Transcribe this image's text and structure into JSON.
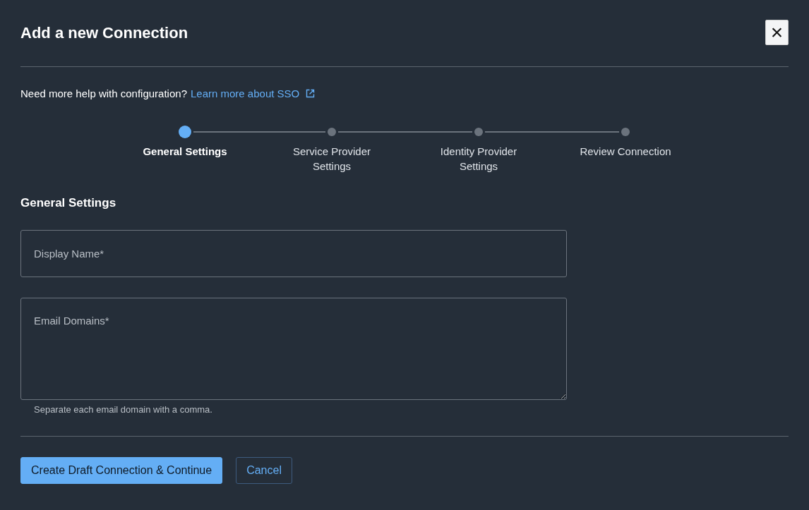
{
  "dialog": {
    "title": "Add a new Connection",
    "close_icon": "×"
  },
  "help": {
    "text": "Need more help with configuration?",
    "link": "Learn more about SSO"
  },
  "steps": [
    {
      "label": "General Settings",
      "selected": true
    },
    {
      "label": "Service Provider Settings",
      "selected": false
    },
    {
      "label": "Identity Provider Settings",
      "selected": false
    },
    {
      "label": "Review Connection",
      "selected": false
    }
  ],
  "section_title": "General Settings",
  "fields": [
    {
      "kind": "input",
      "placeholder": "Display Name*"
    },
    {
      "kind": "textarea",
      "placeholder": "Email Domains*",
      "hint": "Separate each email domain with a comma."
    }
  ],
  "buttons": [
    {
      "kind": "primary",
      "label": "Create Draft Connection & Continue"
    },
    {
      "kind": "secondary",
      "label": "Cancel"
    }
  ]
}
